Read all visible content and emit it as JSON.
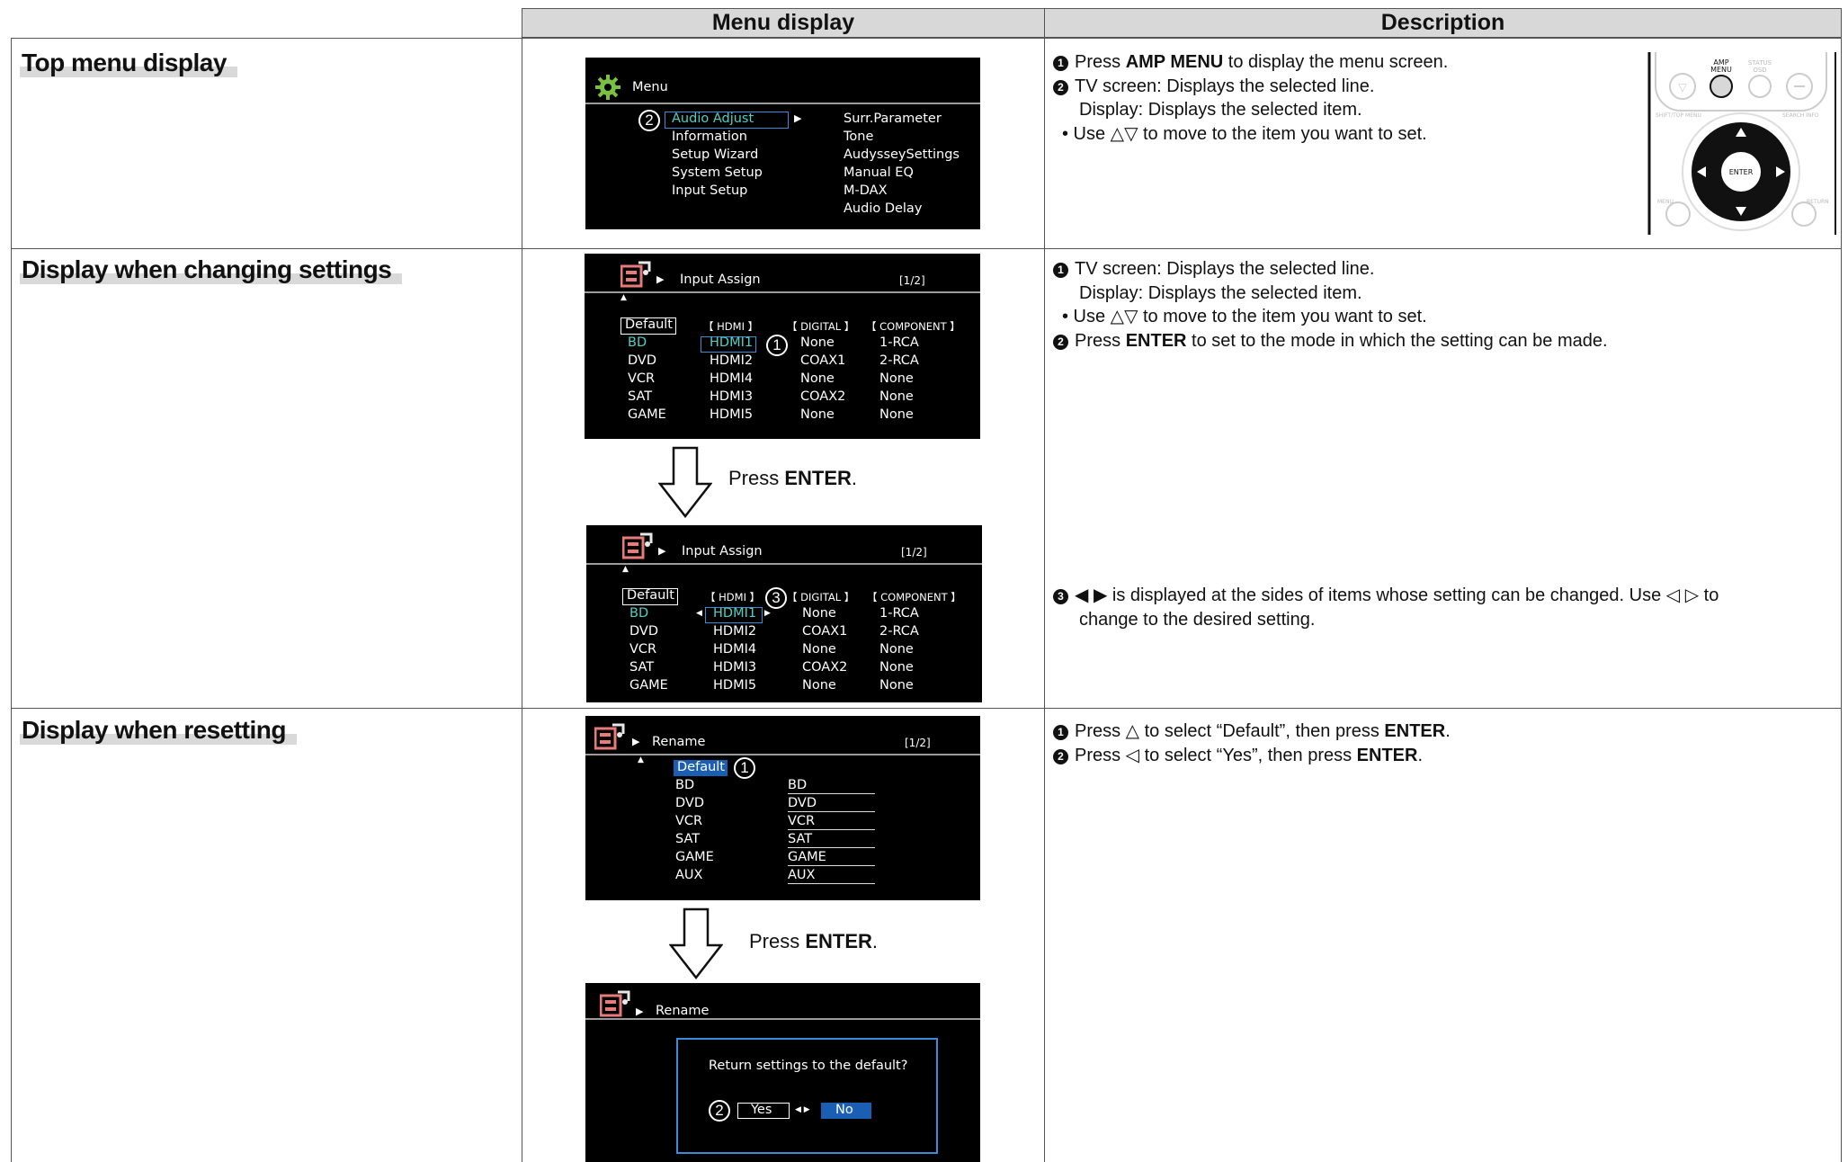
{
  "headers": {
    "menu_display": "Menu display",
    "description": "Description"
  },
  "rows": {
    "top": {
      "title": "Top menu display"
    },
    "changing": {
      "title": "Display when changing settings"
    },
    "resetting": {
      "title": "Display when resetting"
    }
  },
  "screen_top": {
    "title": "Menu",
    "circle": "2",
    "left_items": [
      "Audio Adjust",
      "Information",
      "Setup Wizard",
      "System Setup",
      "Input Setup"
    ],
    "right_items": [
      "Surr.Parameter",
      "Tone",
      "AudysseySettings",
      "Manual EQ",
      "M-DAX",
      "Audio Delay"
    ]
  },
  "screen_input": {
    "title": "Input Assign",
    "page": "[1/2]",
    "default_label": "Default",
    "col_headers": [
      "【 HDMI 】",
      "【 DIGITAL 】",
      "【 COMPONENT 】"
    ],
    "rows": [
      [
        "BD",
        "HDMI1",
        "None",
        "1-RCA"
      ],
      [
        "DVD",
        "HDMI2",
        "COAX1",
        "2-RCA"
      ],
      [
        "VCR",
        "HDMI4",
        "None",
        "None"
      ],
      [
        "SAT",
        "HDMI3",
        "COAX2",
        "None"
      ],
      [
        "GAME",
        "HDMI5",
        "None",
        "None"
      ]
    ],
    "circle1": "1",
    "circle3": "3"
  },
  "press_enter": {
    "prefix": "Press ",
    "key": "ENTER",
    "suffix": "."
  },
  "screen_rename": {
    "title": "Rename",
    "page": "[1/2]",
    "default_label": "Default",
    "circle": "1",
    "names": [
      "BD",
      "DVD",
      "VCR",
      "SAT",
      "GAME",
      "AUX"
    ]
  },
  "screen_reset": {
    "title": "Rename",
    "question": "Return settings to the default?",
    "circle": "2",
    "yes": "Yes",
    "no": "No"
  },
  "remote": {
    "amp_menu": "AMP\nMENU",
    "status_osd": "STATUS\nOSD",
    "shift": "SHIFT/TOP MENU",
    "search": "SEARCH INFO",
    "menu": "MENU",
    "return": "RETURN",
    "enter": "ENTER"
  },
  "desc_top": {
    "l1_a": "Press ",
    "l1_b": "AMP MENU",
    "l1_c": " to display the menu screen.",
    "l2": "TV screen: Displays the selected line.",
    "l3": "Display: Displays the selected item.",
    "l4": "• Use △▽ to move to the item you want to set."
  },
  "desc_change": {
    "l1": "TV screen: Displays the selected line.",
    "l2": "Display: Displays the selected item.",
    "l3": "• Use △▽ to move to the item you want to set.",
    "l4_a": "Press ",
    "l4_b": "ENTER",
    "l4_c": " to set to the mode in which the setting can be made.",
    "l5": "◀  ▶ is displayed at the sides of items whose setting can be changed. Use ◁ ▷ to",
    "l6": "change to the desired setting."
  },
  "desc_reset": {
    "l1_a": "Press △ to select “Default”, then press ",
    "l1_b": "ENTER",
    "l1_c": ".",
    "l2_a": "Press ◁ to select “Yes”, then press ",
    "l2_b": "ENTER",
    "l2_c": "."
  },
  "markers": [
    "1",
    "2",
    "3"
  ]
}
